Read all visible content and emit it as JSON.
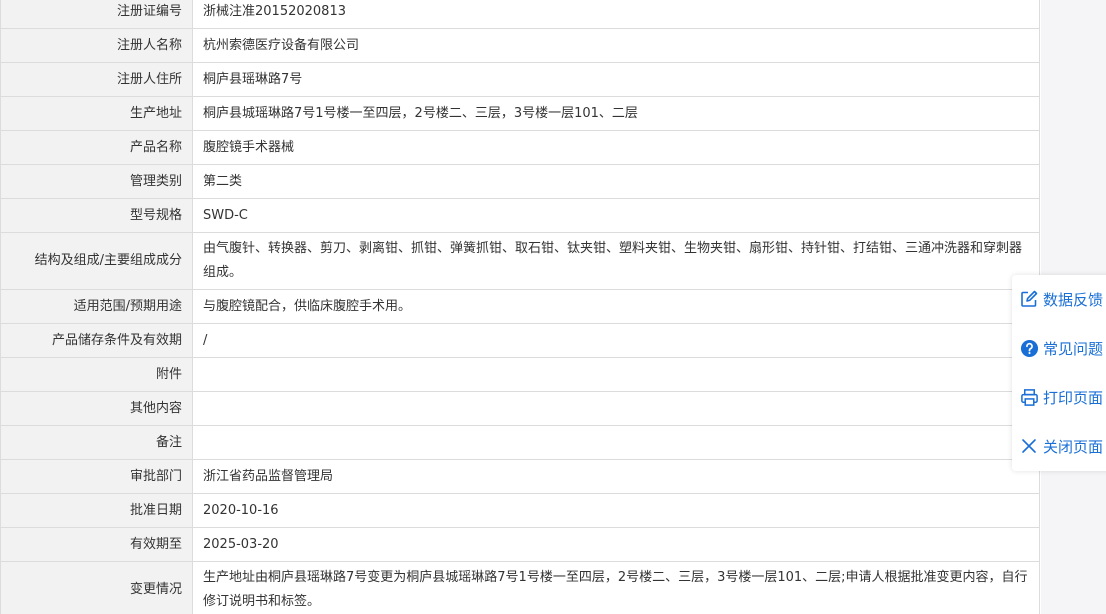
{
  "rows": [
    {
      "label": "注册证编号",
      "value": "浙械注准20152020813"
    },
    {
      "label": "注册人名称",
      "value": "杭州索德医疗设备有限公司"
    },
    {
      "label": "注册人住所",
      "value": "桐庐县瑶琳路7号"
    },
    {
      "label": "生产地址",
      "value": "桐庐县城瑶琳路7号1号楼一至四层，2号楼二、三层，3号楼一层101、二层"
    },
    {
      "label": "产品名称",
      "value": "腹腔镜手术器械"
    },
    {
      "label": "管理类别",
      "value": "第二类"
    },
    {
      "label": "型号规格",
      "value": "SWD-C"
    },
    {
      "label": "结构及组成/主要组成成分",
      "value": "由气腹针、转换器、剪刀、剥离钳、抓钳、弹簧抓钳、取石钳、钛夹钳、塑料夹钳、生物夹钳、扇形钳、持针钳、打结钳、三通冲洗器和穿刺器组成。"
    },
    {
      "label": "适用范围/预期用途",
      "value": "与腹腔镜配合，供临床腹腔手术用。"
    },
    {
      "label": "产品储存条件及有效期",
      "value": "/"
    },
    {
      "label": "附件",
      "value": ""
    },
    {
      "label": "其他内容",
      "value": ""
    },
    {
      "label": "备注",
      "value": ""
    },
    {
      "label": "审批部门",
      "value": "浙江省药品监督管理局"
    },
    {
      "label": "批准日期",
      "value": "2020-10-16"
    },
    {
      "label": "有效期至",
      "value": "2025-03-20"
    },
    {
      "label": "变更情况",
      "value": "生产地址由桐庐县瑶琳路7号变更为桐庐县城瑶琳路7号1号楼一至四层，2号楼二、三层，3号楼一层101、二层;申请人根据批准变更内容，自行修订说明书和标签。"
    }
  ],
  "toolbar": {
    "feedback": "数据反馈",
    "faq": "常见问题",
    "print": "打印页面",
    "close": "关闭页面"
  },
  "icons": {
    "feedback": "edit-icon",
    "faq": "question-circle-icon",
    "print": "printer-icon",
    "close": "close-icon"
  },
  "colors": {
    "link": "#1a6fd6",
    "label_bg": "#f2f2f2",
    "border": "#dcdcdc"
  }
}
